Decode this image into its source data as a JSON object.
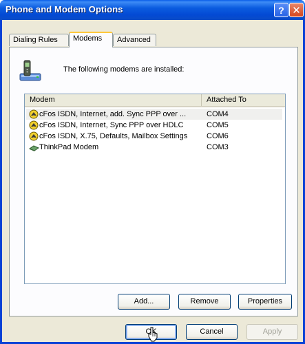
{
  "window": {
    "title": "Phone and Modem Options"
  },
  "titlebar_buttons": {
    "help": "?",
    "close": "✕"
  },
  "tabs": [
    {
      "label": "Dialing Rules",
      "active": false
    },
    {
      "label": "Modems",
      "active": true
    },
    {
      "label": "Advanced",
      "active": false
    }
  ],
  "intro_text": "The following modems are installed:",
  "list": {
    "columns": [
      "Modem",
      "Attached To"
    ],
    "rows": [
      {
        "icon": "isdn-modem-icon",
        "modem": "cFos ISDN, Internet, add. Sync PPP over ...",
        "port": "COM4",
        "selected": true
      },
      {
        "icon": "isdn-modem-icon",
        "modem": "cFos ISDN, Internet, Sync PPP over HDLC",
        "port": "COM5",
        "selected": false
      },
      {
        "icon": "isdn-modem-icon",
        "modem": "cFos ISDN, X.75, Defaults, Mailbox Settings",
        "port": "COM6",
        "selected": false
      },
      {
        "icon": "modem-icon",
        "modem": "ThinkPad Modem",
        "port": "COM3",
        "selected": false
      }
    ]
  },
  "buttons": {
    "add": "Add...",
    "remove": "Remove",
    "properties": "Properties",
    "ok": "OK",
    "cancel": "Cancel",
    "apply": "Apply"
  },
  "colors": {
    "titlebar": "#0842D6",
    "dialog": "#ECE9D8",
    "active_tab_accent": "#FFC83C"
  }
}
